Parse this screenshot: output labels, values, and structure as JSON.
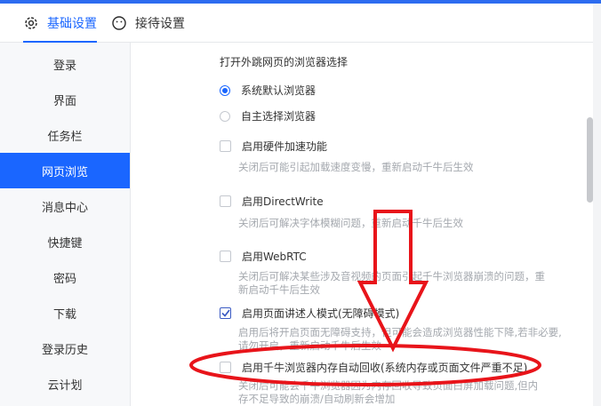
{
  "colors": {
    "accent": "#1a66ff",
    "sidebar_active": "#1a66ff",
    "top_strip": "#2d6cf0",
    "annotation": "#e8141a"
  },
  "tabs": [
    {
      "label": "基础设置",
      "icon": "gear-icon",
      "active": true
    },
    {
      "label": "接待设置",
      "icon": "smiley-icon",
      "active": false
    }
  ],
  "sidebar": {
    "items": [
      {
        "label": "登录"
      },
      {
        "label": "界面"
      },
      {
        "label": "任务栏"
      },
      {
        "label": "网页浏览",
        "active": true
      },
      {
        "label": "消息中心"
      },
      {
        "label": "快捷键"
      },
      {
        "label": "密码"
      },
      {
        "label": "下载"
      },
      {
        "label": "登录历史"
      },
      {
        "label": "云计划"
      }
    ]
  },
  "content": {
    "section_title": "打开外跳网页的浏览器选择",
    "radios": [
      {
        "label": "系统默认浏览器",
        "checked": true
      },
      {
        "label": "自主选择浏览器",
        "checked": false
      }
    ],
    "options": [
      {
        "label": "启用硬件加速功能",
        "checked": false,
        "desc": [
          "关闭后可能引起加载速度变慢，重新启动千牛后生效"
        ]
      },
      {
        "label": "启用DirectWrite",
        "checked": false,
        "desc": [
          "关闭后可解决字体模糊问题，重新启动千牛后生效"
        ]
      },
      {
        "label": "启用WebRTC",
        "checked": false,
        "desc": [
          "关闭后可解决某些涉及音视频的页面引起千牛浏览器崩溃的问题，重",
          "新启动千牛后生效"
        ]
      },
      {
        "label": "启用页面讲述人模式(无障碍模式)",
        "checked": true,
        "desc": [
          "启用后将开启页面无障碍支持，但可能会造成浏览器性能下降,若非必要,",
          "请勿开启，重新启动千牛后生效"
        ]
      },
      {
        "label": "启用千牛浏览器内存自动回收(系统内存或页面文件严重不足)",
        "checked": false,
        "desc": [
          "关闭后可能会千牛浏览器因为内存回收导致页面白屏加载问题,但内",
          "存不足导致的崩溃/自动刷新会增加"
        ]
      }
    ]
  }
}
